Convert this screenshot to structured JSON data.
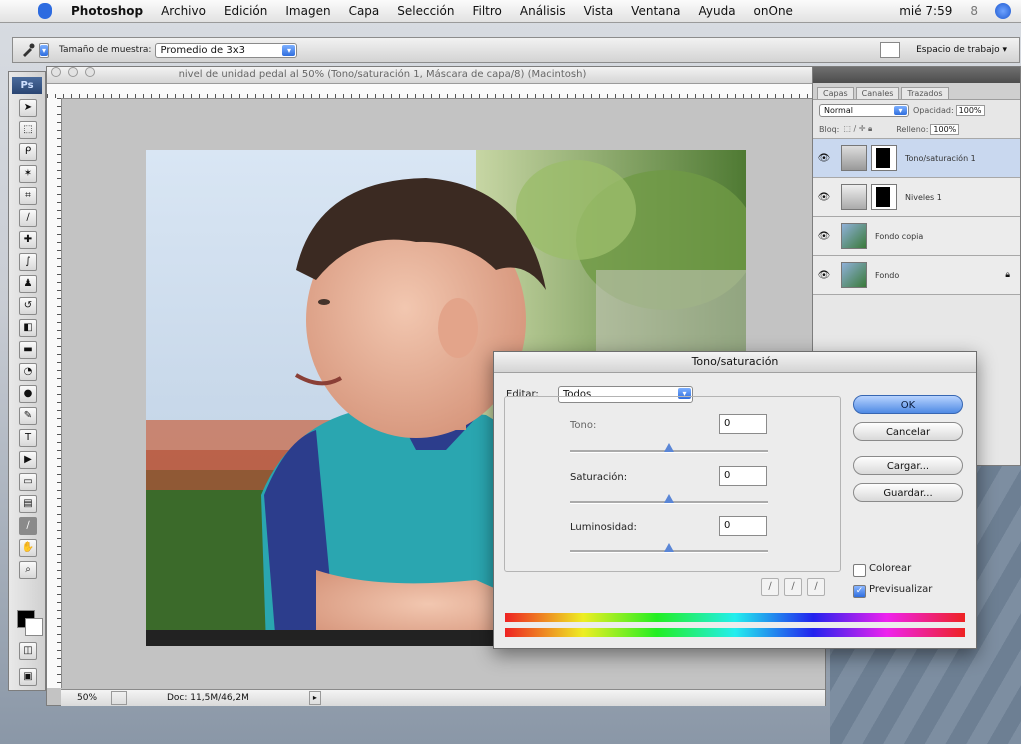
{
  "menubar": {
    "app": "Photoshop",
    "items": [
      "Archivo",
      "Edición",
      "Imagen",
      "Capa",
      "Selección",
      "Filtro",
      "Análisis",
      "Vista",
      "Ventana",
      "Ayuda",
      "onOne"
    ],
    "clock": "mié 7:59",
    "extra": "8"
  },
  "optionsbar": {
    "sample_label": "Tamaño de muestra:",
    "sample_value": "Promedio de 3x3",
    "workspace": "Espacio de trabajo ▾"
  },
  "document": {
    "title": "nivel de unidad pedal al 50% (Tono/saturación 1, Máscara de capa/8) (Macintosh)",
    "zoom": "50%",
    "doc_info": "Doc: 11,5M/46,2M"
  },
  "layers": {
    "tabs": [
      "Capas",
      "Canales",
      "Trazados"
    ],
    "blend_mode": "Normal",
    "opacity_label": "Opacidad:",
    "opacity": "100%",
    "lock_label": "Bloq:",
    "fill_label": "Relleno:",
    "fill": "100%",
    "items": [
      {
        "name": "Tono/saturación 1",
        "selected": true
      },
      {
        "name": "Niveles 1",
        "selected": false
      },
      {
        "name": "Fondo copia",
        "selected": false
      },
      {
        "name": "Fondo",
        "selected": false
      }
    ]
  },
  "dialog": {
    "title": "Tono/saturación",
    "edit_label": "Editar:",
    "edit_value": "Todos",
    "hue_label": "Tono:",
    "hue_value": "0",
    "sat_label": "Saturación:",
    "sat_value": "0",
    "light_label": "Luminosidad:",
    "light_value": "0",
    "ok": "OK",
    "cancel": "Cancelar",
    "load": "Cargar...",
    "save": "Guardar...",
    "colorize": "Colorear",
    "preview": "Previsualizar",
    "preview_checked": true,
    "colorize_checked": false
  }
}
